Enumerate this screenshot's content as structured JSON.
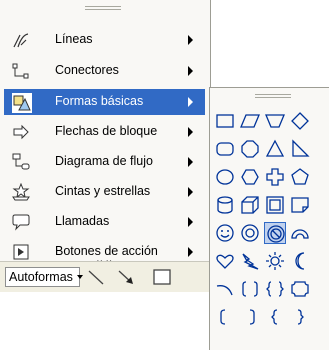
{
  "menu": {
    "items": [
      {
        "label": "Líneas",
        "icon": "lines-icon",
        "has_submenu": true
      },
      {
        "label": "Conectores",
        "icon": "connectors-icon",
        "has_submenu": true
      },
      {
        "label": "Formas básicas",
        "icon": "basic-shapes-icon",
        "has_submenu": true,
        "selected": true
      },
      {
        "label": "Flechas de bloque",
        "icon": "block-arrows-icon",
        "has_submenu": true
      },
      {
        "label": "Diagrama de flujo",
        "icon": "flowchart-icon",
        "has_submenu": true
      },
      {
        "label": "Cintas y estrellas",
        "icon": "stars-banners-icon",
        "has_submenu": true
      },
      {
        "label": "Llamadas",
        "icon": "callouts-icon",
        "has_submenu": true
      },
      {
        "label": "Botones de acción",
        "icon": "action-buttons-icon",
        "has_submenu": true
      }
    ],
    "expand_glyph": "⌄⌄"
  },
  "toolbar": {
    "autoshapes_label": "Autoformas",
    "tools": [
      "line-tool-icon",
      "arrow-tool-icon",
      "rectangle-tool-icon"
    ]
  },
  "palette": {
    "selected_shape": "no-symbol",
    "rows": [
      [
        "rectangle",
        "parallelogram",
        "trapezoid",
        "diamond"
      ],
      [
        "rounded-rectangle",
        "octagon",
        "triangle",
        "right-triangle"
      ],
      [
        "oval",
        "hexagon",
        "cross",
        "pentagon"
      ],
      [
        "can",
        "cube",
        "bevel",
        "folded-corner"
      ],
      [
        "smiley-face",
        "donut",
        "no-symbol",
        "block-arc"
      ],
      [
        "heart",
        "lightning-bolt",
        "sun",
        "moon"
      ],
      [
        "arc",
        "double-bracket",
        "double-brace",
        "plaque"
      ],
      [
        "left-bracket",
        "right-bracket",
        "left-brace",
        "right-brace"
      ]
    ]
  }
}
